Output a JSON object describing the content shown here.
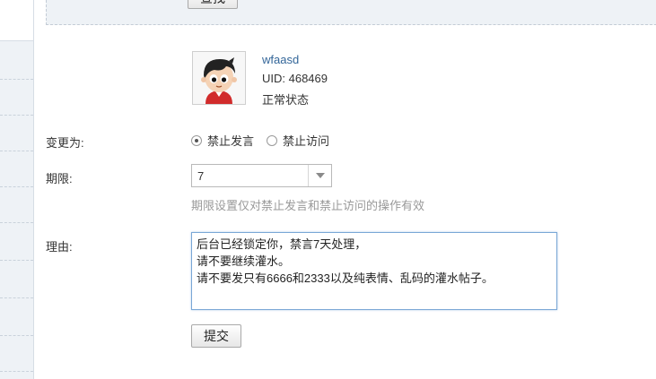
{
  "top": {
    "button_label": "查找"
  },
  "user": {
    "name": "wfaasd",
    "uid": "UID: 468469",
    "status": "正常状态"
  },
  "form": {
    "change_label": "变更为:",
    "options": [
      {
        "label": "禁止发言",
        "checked": true
      },
      {
        "label": "禁止访问",
        "checked": false
      }
    ],
    "period_label": "期限:",
    "period_value": "7",
    "period_hint": "期限设置仅对禁止发言和禁止访问的操作有效",
    "reason_label": "理由:",
    "reason_lines": [
      "后台已经锁定你，禁言7天处理，",
      "请不要继续灌水。",
      "请不要发只有6666和2333以及纯表情、乱码的灌水帖子。"
    ],
    "submit_label": "提交"
  },
  "colors": {
    "link": "#336699",
    "panel_bg": "#eef2f6",
    "focus_border": "#7aa7d6"
  }
}
